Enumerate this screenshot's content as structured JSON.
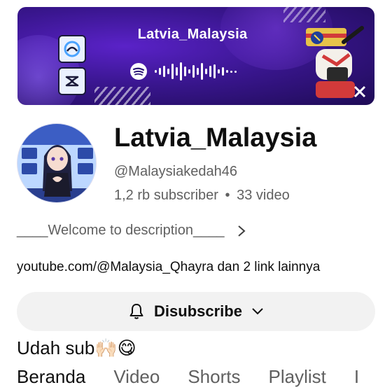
{
  "banner": {
    "title": "Latvia_Malaysia",
    "icons": [
      "app-tile-icon",
      "capcut-icon",
      "spotify-icon",
      "spotify-code-wave"
    ],
    "colors": {
      "bg_dark": "#1e0b55",
      "bg_mid": "#3a1690",
      "bg_glow": "#5a22c8"
    }
  },
  "channel": {
    "name": "Latvia_Malaysia",
    "handle": "@Malaysiakedah46",
    "subscribers": "1,2 rb subscriber",
    "separator": "•",
    "videos": "33 video"
  },
  "description": {
    "text": "____Welcome to description____",
    "chevron": "›"
  },
  "links": {
    "primary": "youtube.com/@Malaysia_Qhayra",
    "more": "dan 2 link lainnya"
  },
  "subscribe": {
    "label": "Disubscribe",
    "icons": [
      "bell-icon",
      "chevron-down-icon"
    ]
  },
  "comment": {
    "text": "Udah sub",
    "emoji": "🙌🏻😋"
  },
  "tabs": [
    {
      "label": "Beranda"
    },
    {
      "label": "Video"
    },
    {
      "label": "Shorts"
    },
    {
      "label": "Playlist"
    },
    {
      "label": "I"
    }
  ]
}
